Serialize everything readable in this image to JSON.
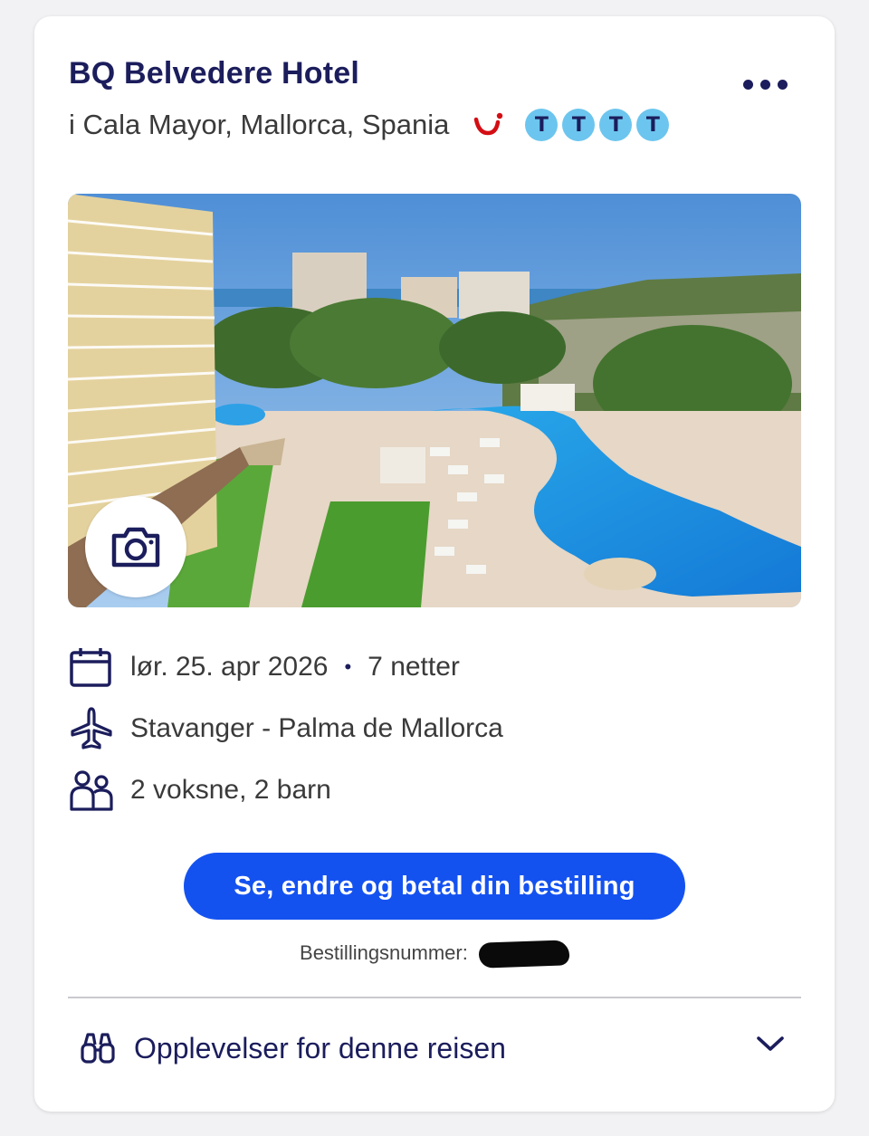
{
  "hotel": {
    "name": "BQ Belvedere Hotel",
    "location": "i Cala Mayor, Mallorca, Spania",
    "rating_letters": [
      "T",
      "T",
      "T",
      "T"
    ]
  },
  "colors": {
    "brand_navy": "#1b1d5c",
    "cta_blue": "#1452f0",
    "rating_blue": "#6cc5ee",
    "tui_red": "#d40e14"
  },
  "icons": {
    "menu": "more-dots-icon",
    "brand": "tui-smile-logo",
    "photo": "camera-icon",
    "date": "calendar-icon",
    "flight": "plane-icon",
    "travellers": "people-icon",
    "experiences": "binoculars-icon",
    "expand": "chevron-down-icon"
  },
  "trip": {
    "date": "lør. 25. apr 2026",
    "separator": "•",
    "nights": "7 netter",
    "route": "Stavanger - Palma de Mallorca",
    "travellers": "2 voksne, 2 barn"
  },
  "actions": {
    "cta_label": "Se, endre og betal din bestilling"
  },
  "booking": {
    "label": "Bestillingsnummer:"
  },
  "experiences": {
    "label": "Opplevelser for denne reisen"
  }
}
